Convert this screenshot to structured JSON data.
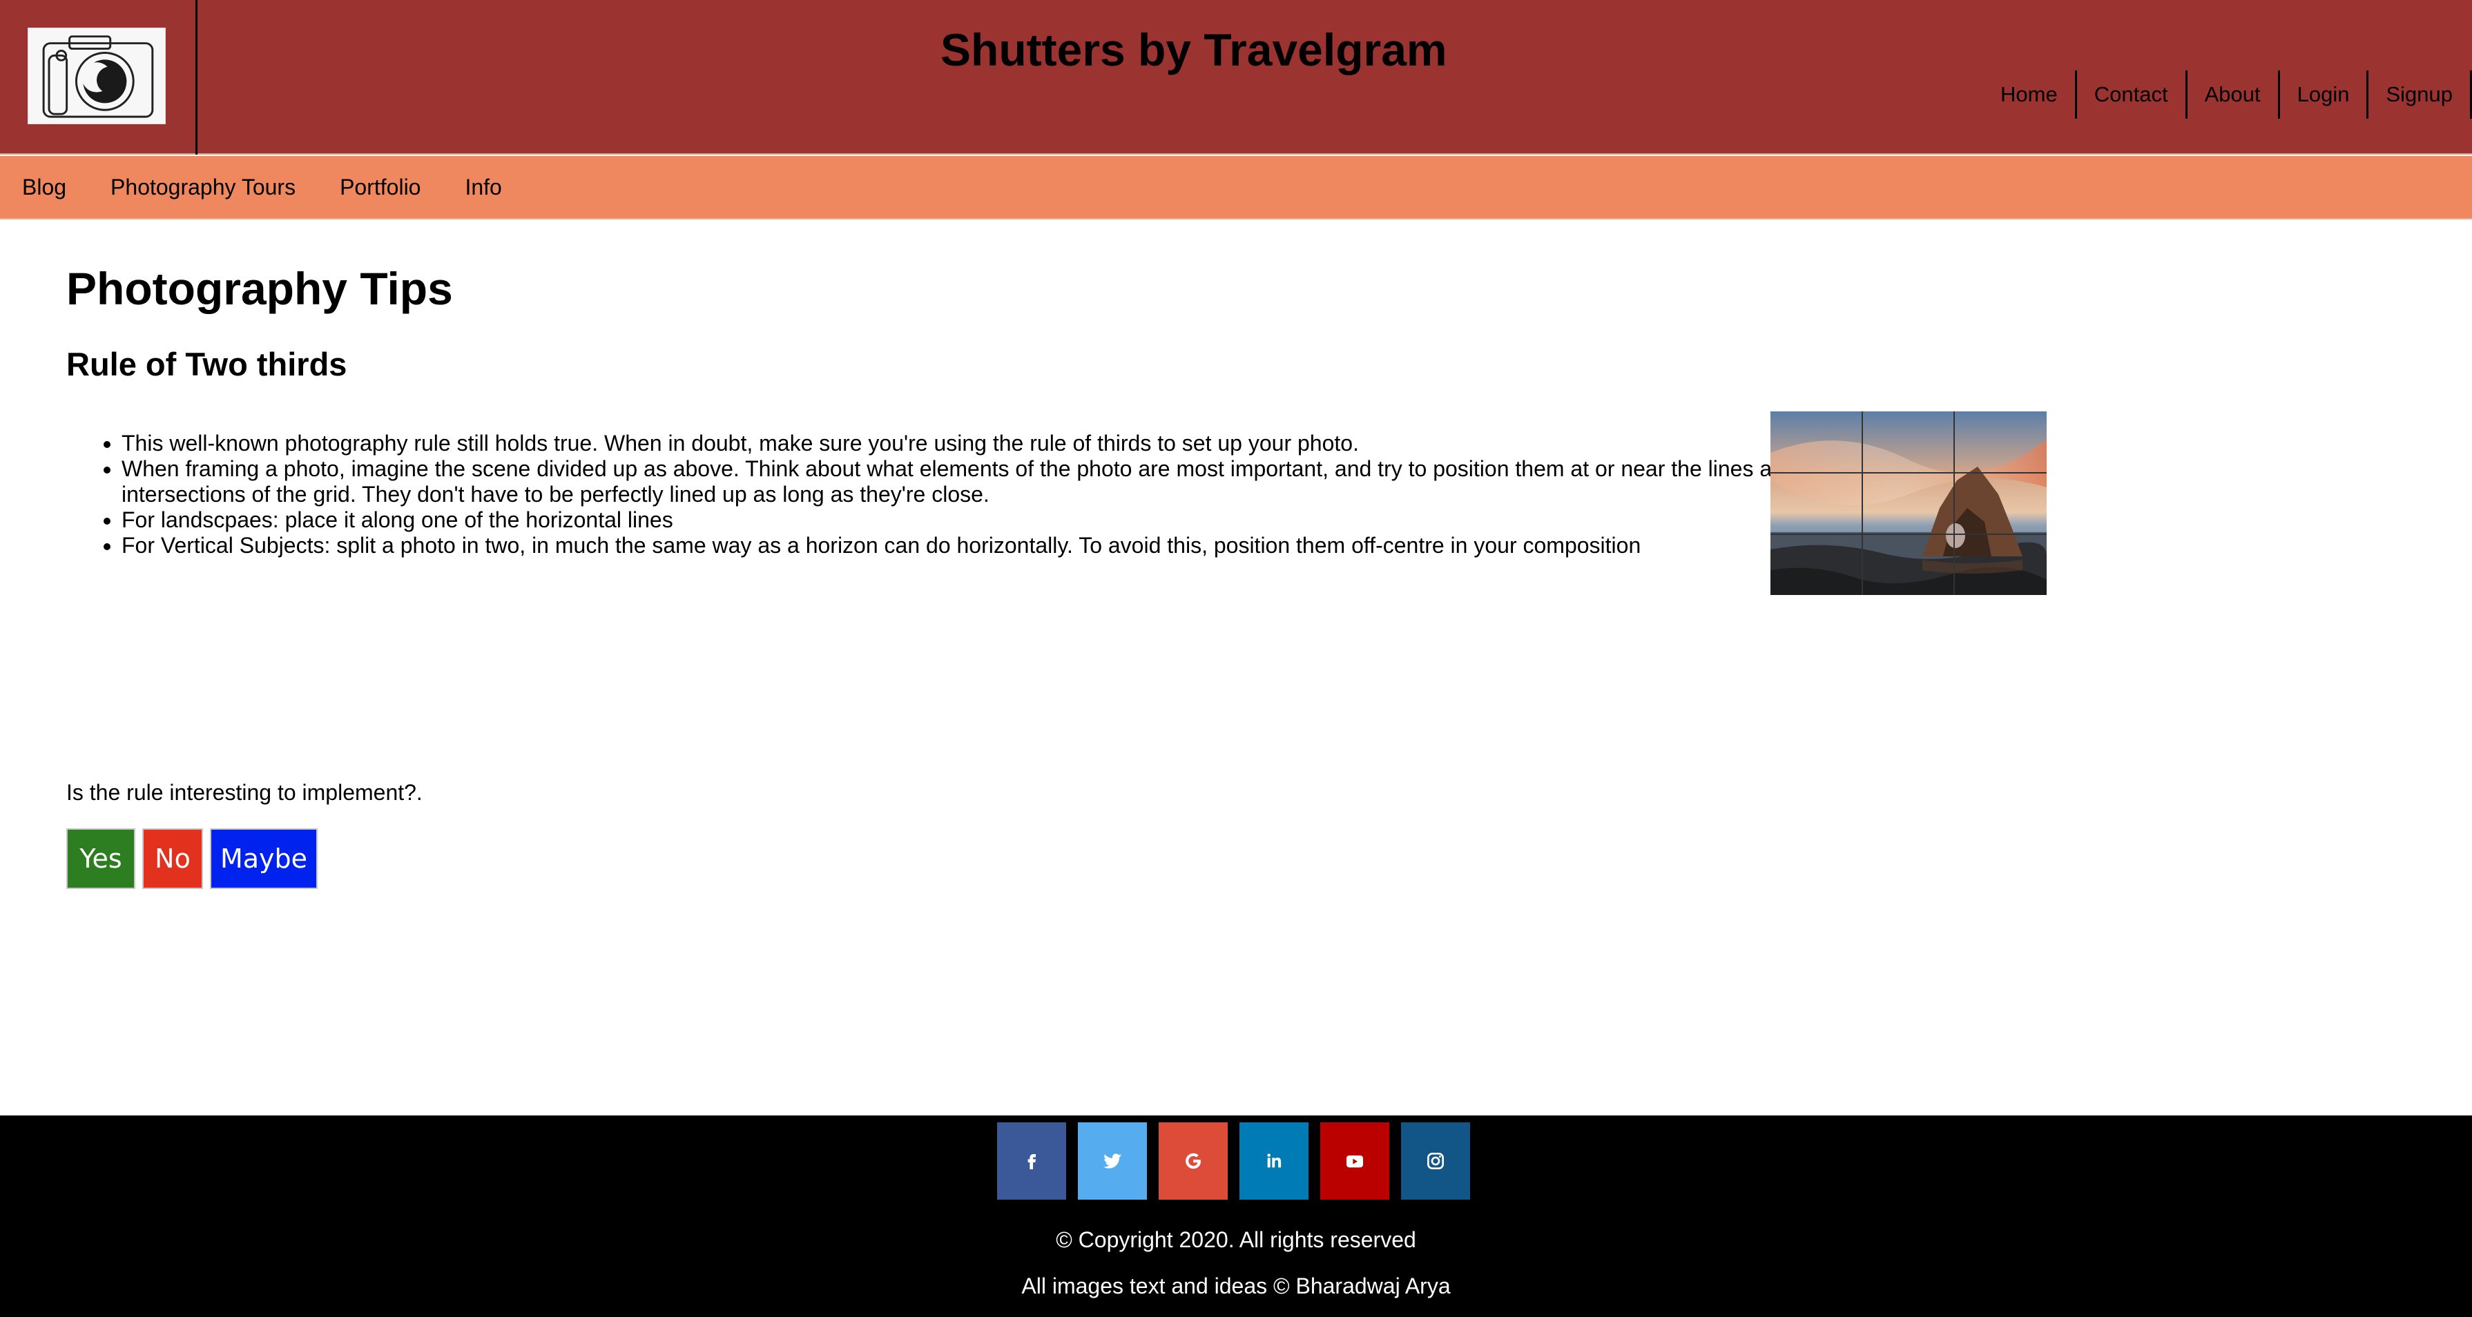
{
  "header": {
    "site_title": "Shutters by Travelgram",
    "logo_icon": "camera-icon",
    "nav": [
      "Home",
      "Contact",
      "About",
      "Login",
      "Signup"
    ],
    "background": "#9b3331"
  },
  "subnav": {
    "items": [
      "Blog",
      "Photography Tours",
      "Portfolio",
      "Info"
    ],
    "background": "#f0885f"
  },
  "main": {
    "page_title": "Photography Tips",
    "section_title": "Rule of Two thirds",
    "tips": [
      "This well-known photography rule still holds true. When in doubt, make sure you're using the rule of thirds to set up your photo.",
      "When framing a photo, imagine the scene divided up as above. Think about what elements of the photo are most important, and try to position them at or near the lines and intersections of the grid. They don't have to be perfectly lined up as long as they're close.",
      "For landscpaes: place it along one of the horizontal lines",
      "For Vertical Subjects: split a photo in two, in much the same way as a horizon can do horizontally. To avoid this, position them off-centre in your composition"
    ],
    "poll": {
      "question": "Is the rule interesting to implement?.",
      "yes_label": "Yes",
      "no_label": "No",
      "maybe_label": "Maybe",
      "colors": {
        "yes": "#2c7e20",
        "no": "#e2321e",
        "maybe": "#0022ee"
      }
    }
  },
  "footer": {
    "social": [
      {
        "name": "facebook-icon",
        "color": "#3b5998"
      },
      {
        "name": "twitter-icon",
        "color": "#55acee"
      },
      {
        "name": "google-icon",
        "color": "#dd4b39"
      },
      {
        "name": "linkedin-icon",
        "color": "#007bb5"
      },
      {
        "name": "youtube-icon",
        "color": "#bb0000"
      },
      {
        "name": "instagram-icon",
        "color": "#125688"
      }
    ],
    "copyright": "© Copyright 2020. All rights reserved",
    "credits": "All images text and ideas © Bharadwaj Arya"
  }
}
